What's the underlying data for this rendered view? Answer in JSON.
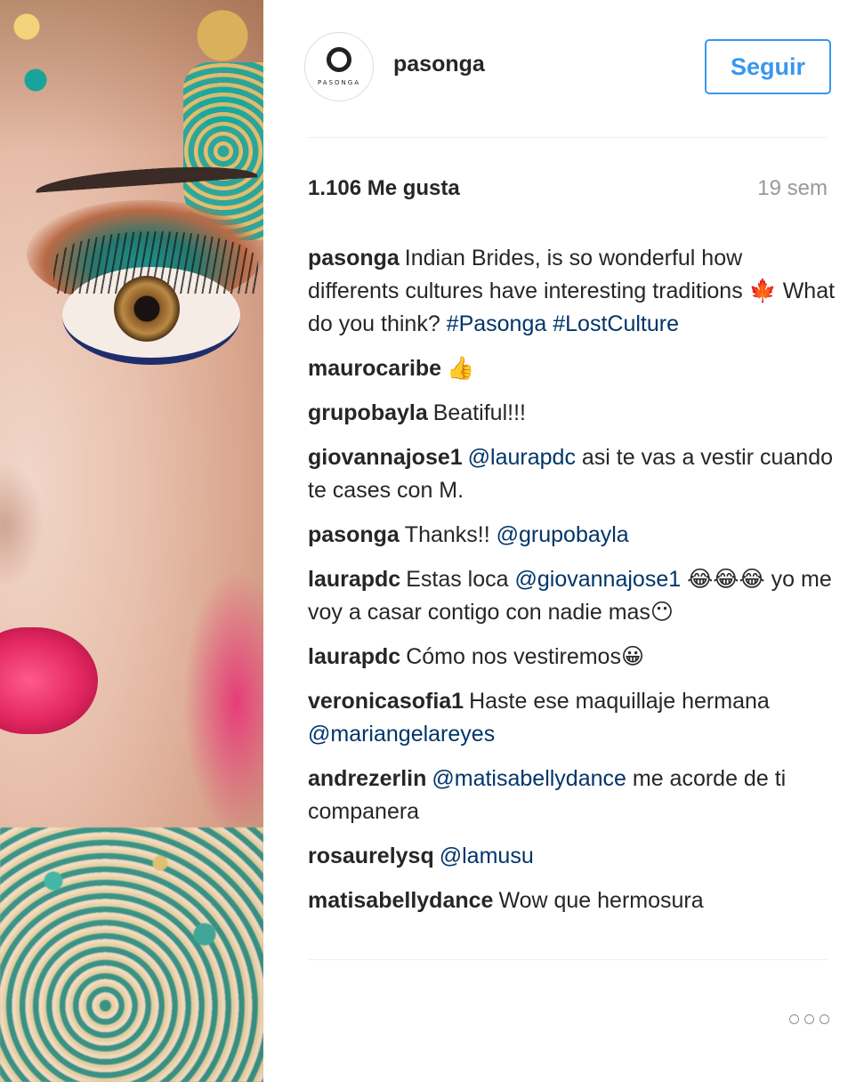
{
  "profile": {
    "username": "pasonga",
    "avatar_brand": "PASONGA",
    "follow_label": "Seguir"
  },
  "post": {
    "likes": "1.106 Me gusta",
    "time": "19 sem"
  },
  "comments": [
    {
      "user": "pasonga",
      "parts": [
        "Indian Brides, is so wonderful how differents cultures have interesting traditions 🍁 What do you think?",
        "#Pasonga",
        "#LostCulture"
      ]
    },
    {
      "user": "maurocaribe",
      "parts": [
        "👍"
      ]
    },
    {
      "user": "grupobayla",
      "parts": [
        "Beatiful!!!"
      ]
    },
    {
      "user": "giovannajose1",
      "parts": [
        "@laurapdc",
        "asi te vas a vestir cuando te cases con M."
      ]
    },
    {
      "user": "pasonga",
      "parts": [
        "Thanks!!",
        "@grupobayla"
      ]
    },
    {
      "user": "laurapdc",
      "parts": [
        "Estas loca",
        "@giovannajose1",
        "😂😂😂 yo me voy a casar contigo con nadie mas😶"
      ]
    },
    {
      "user": "laurapdc",
      "parts": [
        "Cómo nos vestiremos😀"
      ]
    },
    {
      "user": "veronicasofia1",
      "parts": [
        "Haste ese maquillaje hermana",
        "@mariangelareyes"
      ]
    },
    {
      "user": "andrezerlin",
      "parts": [
        "@matisabellydance",
        "me acorde de ti companera"
      ]
    },
    {
      "user": "rosaurelysq",
      "parts": [
        "@lamusu"
      ]
    },
    {
      "user": "matisabellydance",
      "parts": [
        "Wow que hermosura"
      ]
    }
  ],
  "colors": {
    "accent": "#3897f0",
    "mention": "#003569",
    "text": "#262626",
    "muted": "#999999"
  },
  "icons": {
    "more": "more-options-icon"
  }
}
